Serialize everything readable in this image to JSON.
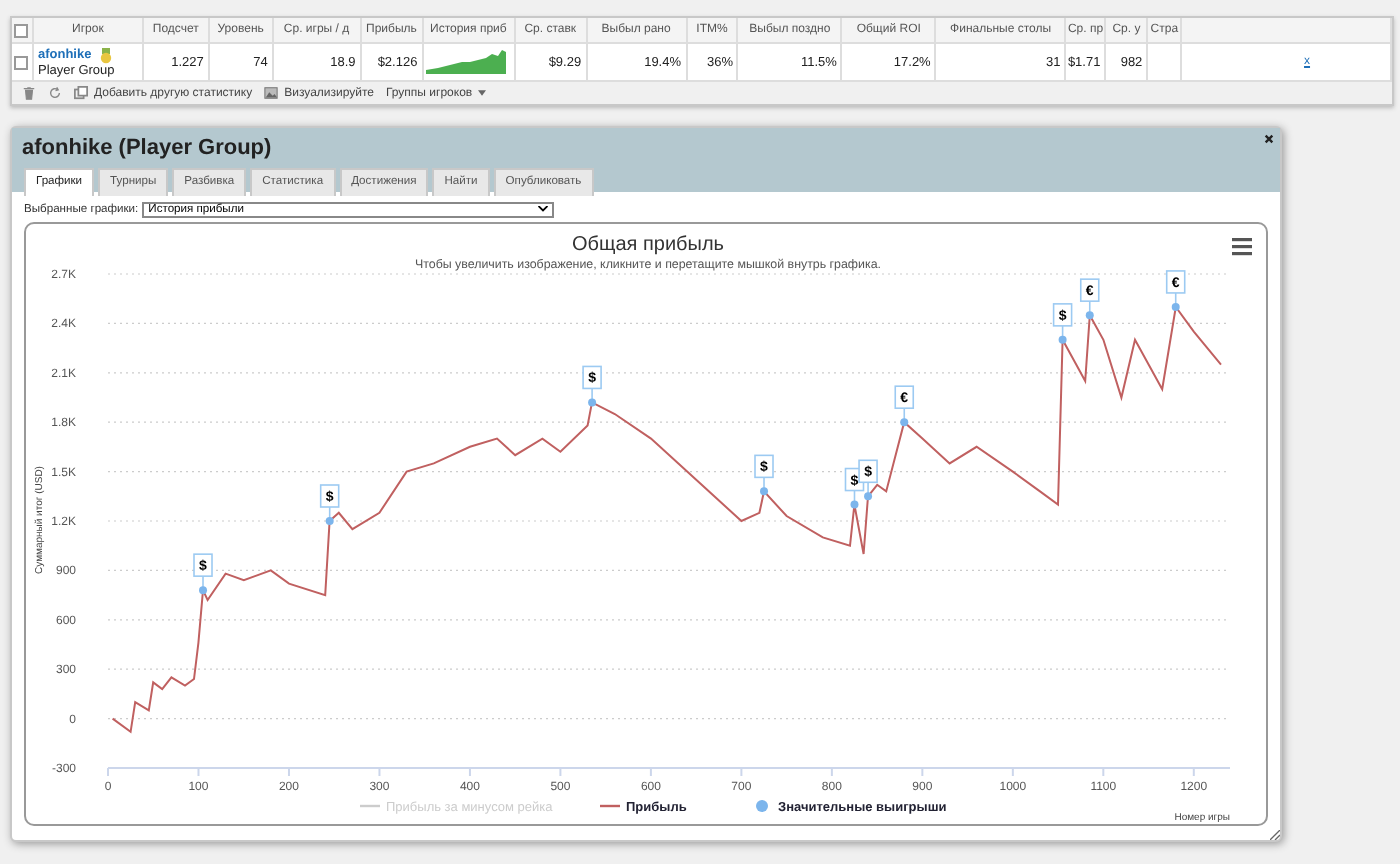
{
  "stats_table": {
    "columns": [
      "Игрок",
      "Подсчет",
      "Уровень",
      "Ср. игры / д",
      "Прибыль",
      "История приб",
      "Ср. ставк",
      "Выбыл рано",
      "ITM%",
      "Выбыл поздно",
      "Общий ROI",
      "Финальные столы",
      "Ср. пр",
      "Ср. у",
      "Стра"
    ],
    "header_checked": false,
    "rows": [
      {
        "checked": false,
        "cells": [
          {
            "kind": "player",
            "player": "afonhike",
            "group": "Player Group"
          },
          {
            "kind": "text",
            "text": "1.227"
          },
          {
            "kind": "text",
            "text": "74"
          },
          {
            "kind": "text",
            "text": "18.9"
          },
          {
            "kind": "text",
            "text": "$2.126"
          },
          {
            "kind": "sparkline"
          },
          {
            "kind": "text",
            "text": "$9.29"
          },
          {
            "kind": "text",
            "text": "19.4%"
          },
          {
            "kind": "text",
            "text": "36%"
          },
          {
            "kind": "text",
            "text": "11.5%"
          },
          {
            "kind": "text",
            "text": "17.2%"
          },
          {
            "kind": "text",
            "text": "31"
          },
          {
            "kind": "text",
            "text": "$1.71"
          },
          {
            "kind": "text",
            "text": "982"
          },
          {
            "kind": "blank"
          },
          {
            "kind": "link",
            "text": "x"
          }
        ]
      }
    ],
    "toolbar": [
      {
        "kind": "trash"
      },
      {
        "kind": "refresh"
      },
      {
        "kind": "add",
        "label": "Добавить другую статистику"
      },
      {
        "kind": "visual",
        "label": "Визуализируйте"
      },
      {
        "kind": "dropdown",
        "label": "Группы игроков"
      }
    ]
  },
  "panel": {
    "title": "afonhike (Player Group)",
    "tabs": [
      {
        "label": "Графики",
        "selected": true
      },
      {
        "label": "Турниры",
        "selected": false
      },
      {
        "label": "Разбивка",
        "selected": false
      },
      {
        "label": "Статистика",
        "selected": false
      },
      {
        "label": "Достижения",
        "selected": false
      },
      {
        "label": "Найти",
        "selected": false
      },
      {
        "label": "Опубликовать",
        "selected": false
      }
    ],
    "graph_select": {
      "label": "Выбранные графики:",
      "value": "История прибыли"
    },
    "chart": {
      "subtitle": "Чтобы увеличить изображение, кликните и перетащите мышкой внутрь графика.",
      "hidden_legend_item": {
        "label": "Прибыль за минусом рейка",
        "visible": false
      },
      "win_labels": [
        "$",
        "$",
        "$",
        "$",
        "$",
        "$",
        "€",
        "$",
        "€",
        "€"
      ],
      "chart_data": {
        "type": "line",
        "title": "Общая прибыль",
        "xlabel": "Номер игры",
        "ylabel": "Суммарный итог (USD)",
        "grid": true,
        "legend": "bottom",
        "xlim": [
          0,
          1240
        ],
        "ylim": [
          -300,
          2700
        ],
        "xticks": [
          0,
          100,
          200,
          300,
          400,
          500,
          600,
          700,
          800,
          900,
          1000,
          1100,
          1200
        ],
        "yticks": [
          -300,
          0,
          300,
          600,
          900,
          {
            "value": 1200,
            "label": "1.2K"
          },
          {
            "value": 1500,
            "label": "1.5K"
          },
          {
            "value": 1800,
            "label": "1.8K"
          },
          {
            "value": 2100,
            "label": "2.1K"
          },
          {
            "value": 2400,
            "label": "2.4K"
          },
          {
            "value": 2700,
            "label": "2.7K"
          }
        ],
        "x": [
          5,
          25,
          30,
          45,
          50,
          60,
          70,
          85,
          95,
          100,
          105,
          110,
          130,
          150,
          180,
          200,
          240,
          245,
          255,
          270,
          300,
          330,
          360,
          400,
          430,
          450,
          480,
          500,
          530,
          535,
          560,
          600,
          650,
          700,
          720,
          725,
          750,
          790,
          820,
          825,
          835,
          840,
          850,
          860,
          880,
          900,
          930,
          960,
          1000,
          1030,
          1050,
          1055,
          1070,
          1080,
          1085,
          1100,
          1120,
          1135,
          1150,
          1165,
          1180,
          1200,
          1230
        ],
        "series": [
          {
            "name": "Прибыль",
            "color": "#c06060",
            "values": [
              0,
              -80,
              100,
              50,
              220,
              180,
              250,
              200,
              240,
              460,
              780,
              720,
              880,
              840,
              900,
              820,
              750,
              1200,
              1250,
              1150,
              1250,
              1500,
              1550,
              1650,
              1700,
              1600,
              1700,
              1620,
              1780,
              1920,
              1850,
              1700,
              1450,
              1200,
              1250,
              1380,
              1230,
              1100,
              1050,
              1300,
              1000,
              1350,
              1420,
              1380,
              1800,
              1700,
              1550,
              1650,
              1500,
              1380,
              1300,
              2300,
              2150,
              2050,
              2450,
              2300,
              1950,
              2300,
              2150,
              2000,
              2500,
              2350,
              2150
            ]
          },
          {
            "name": "Значительные выигрыши",
            "type": "scatter",
            "color": "#7cb5ec",
            "values": [
              null,
              null,
              null,
              null,
              null,
              null,
              null,
              null,
              null,
              null,
              780,
              null,
              null,
              null,
              null,
              null,
              null,
              1200,
              null,
              null,
              null,
              null,
              null,
              null,
              null,
              null,
              null,
              null,
              null,
              1920,
              null,
              null,
              null,
              null,
              null,
              1380,
              null,
              null,
              null,
              1300,
              null,
              1350,
              null,
              null,
              1800,
              null,
              null,
              null,
              null,
              null,
              null,
              2300,
              null,
              null,
              2450,
              null,
              null,
              null,
              null,
              null,
              2500,
              null,
              null
            ]
          }
        ]
      }
    }
  }
}
